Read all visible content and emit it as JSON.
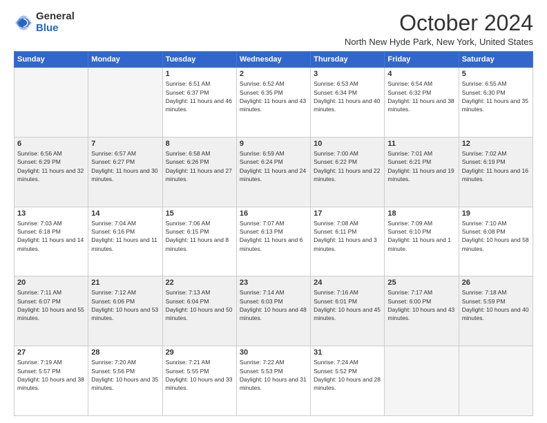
{
  "header": {
    "logo_general": "General",
    "logo_blue": "Blue",
    "month_title": "October 2024",
    "location": "North New Hyde Park, New York, United States"
  },
  "days_of_week": [
    "Sunday",
    "Monday",
    "Tuesday",
    "Wednesday",
    "Thursday",
    "Friday",
    "Saturday"
  ],
  "weeks": [
    [
      {
        "day": "",
        "info": ""
      },
      {
        "day": "",
        "info": ""
      },
      {
        "day": "1",
        "info": "Sunrise: 6:51 AM\nSunset: 6:37 PM\nDaylight: 11 hours and 46 minutes."
      },
      {
        "day": "2",
        "info": "Sunrise: 6:52 AM\nSunset: 6:35 PM\nDaylight: 11 hours and 43 minutes."
      },
      {
        "day": "3",
        "info": "Sunrise: 6:53 AM\nSunset: 6:34 PM\nDaylight: 11 hours and 40 minutes."
      },
      {
        "day": "4",
        "info": "Sunrise: 6:54 AM\nSunset: 6:32 PM\nDaylight: 11 hours and 38 minutes."
      },
      {
        "day": "5",
        "info": "Sunrise: 6:55 AM\nSunset: 6:30 PM\nDaylight: 11 hours and 35 minutes."
      }
    ],
    [
      {
        "day": "6",
        "info": "Sunrise: 6:56 AM\nSunset: 6:29 PM\nDaylight: 11 hours and 32 minutes."
      },
      {
        "day": "7",
        "info": "Sunrise: 6:57 AM\nSunset: 6:27 PM\nDaylight: 11 hours and 30 minutes."
      },
      {
        "day": "8",
        "info": "Sunrise: 6:58 AM\nSunset: 6:26 PM\nDaylight: 11 hours and 27 minutes."
      },
      {
        "day": "9",
        "info": "Sunrise: 6:59 AM\nSunset: 6:24 PM\nDaylight: 11 hours and 24 minutes."
      },
      {
        "day": "10",
        "info": "Sunrise: 7:00 AM\nSunset: 6:22 PM\nDaylight: 11 hours and 22 minutes."
      },
      {
        "day": "11",
        "info": "Sunrise: 7:01 AM\nSunset: 6:21 PM\nDaylight: 11 hours and 19 minutes."
      },
      {
        "day": "12",
        "info": "Sunrise: 7:02 AM\nSunset: 6:19 PM\nDaylight: 11 hours and 16 minutes."
      }
    ],
    [
      {
        "day": "13",
        "info": "Sunrise: 7:03 AM\nSunset: 6:18 PM\nDaylight: 11 hours and 14 minutes."
      },
      {
        "day": "14",
        "info": "Sunrise: 7:04 AM\nSunset: 6:16 PM\nDaylight: 11 hours and 11 minutes."
      },
      {
        "day": "15",
        "info": "Sunrise: 7:06 AM\nSunset: 6:15 PM\nDaylight: 11 hours and 8 minutes."
      },
      {
        "day": "16",
        "info": "Sunrise: 7:07 AM\nSunset: 6:13 PM\nDaylight: 11 hours and 6 minutes."
      },
      {
        "day": "17",
        "info": "Sunrise: 7:08 AM\nSunset: 6:11 PM\nDaylight: 11 hours and 3 minutes."
      },
      {
        "day": "18",
        "info": "Sunrise: 7:09 AM\nSunset: 6:10 PM\nDaylight: 11 hours and 1 minute."
      },
      {
        "day": "19",
        "info": "Sunrise: 7:10 AM\nSunset: 6:08 PM\nDaylight: 10 hours and 58 minutes."
      }
    ],
    [
      {
        "day": "20",
        "info": "Sunrise: 7:11 AM\nSunset: 6:07 PM\nDaylight: 10 hours and 55 minutes."
      },
      {
        "day": "21",
        "info": "Sunrise: 7:12 AM\nSunset: 6:06 PM\nDaylight: 10 hours and 53 minutes."
      },
      {
        "day": "22",
        "info": "Sunrise: 7:13 AM\nSunset: 6:04 PM\nDaylight: 10 hours and 50 minutes."
      },
      {
        "day": "23",
        "info": "Sunrise: 7:14 AM\nSunset: 6:03 PM\nDaylight: 10 hours and 48 minutes."
      },
      {
        "day": "24",
        "info": "Sunrise: 7:16 AM\nSunset: 6:01 PM\nDaylight: 10 hours and 45 minutes."
      },
      {
        "day": "25",
        "info": "Sunrise: 7:17 AM\nSunset: 6:00 PM\nDaylight: 10 hours and 43 minutes."
      },
      {
        "day": "26",
        "info": "Sunrise: 7:18 AM\nSunset: 5:59 PM\nDaylight: 10 hours and 40 minutes."
      }
    ],
    [
      {
        "day": "27",
        "info": "Sunrise: 7:19 AM\nSunset: 5:57 PM\nDaylight: 10 hours and 38 minutes."
      },
      {
        "day": "28",
        "info": "Sunrise: 7:20 AM\nSunset: 5:56 PM\nDaylight: 10 hours and 35 minutes."
      },
      {
        "day": "29",
        "info": "Sunrise: 7:21 AM\nSunset: 5:55 PM\nDaylight: 10 hours and 33 minutes."
      },
      {
        "day": "30",
        "info": "Sunrise: 7:22 AM\nSunset: 5:53 PM\nDaylight: 10 hours and 31 minutes."
      },
      {
        "day": "31",
        "info": "Sunrise: 7:24 AM\nSunset: 5:52 PM\nDaylight: 10 hours and 28 minutes."
      },
      {
        "day": "",
        "info": ""
      },
      {
        "day": "",
        "info": ""
      }
    ]
  ]
}
